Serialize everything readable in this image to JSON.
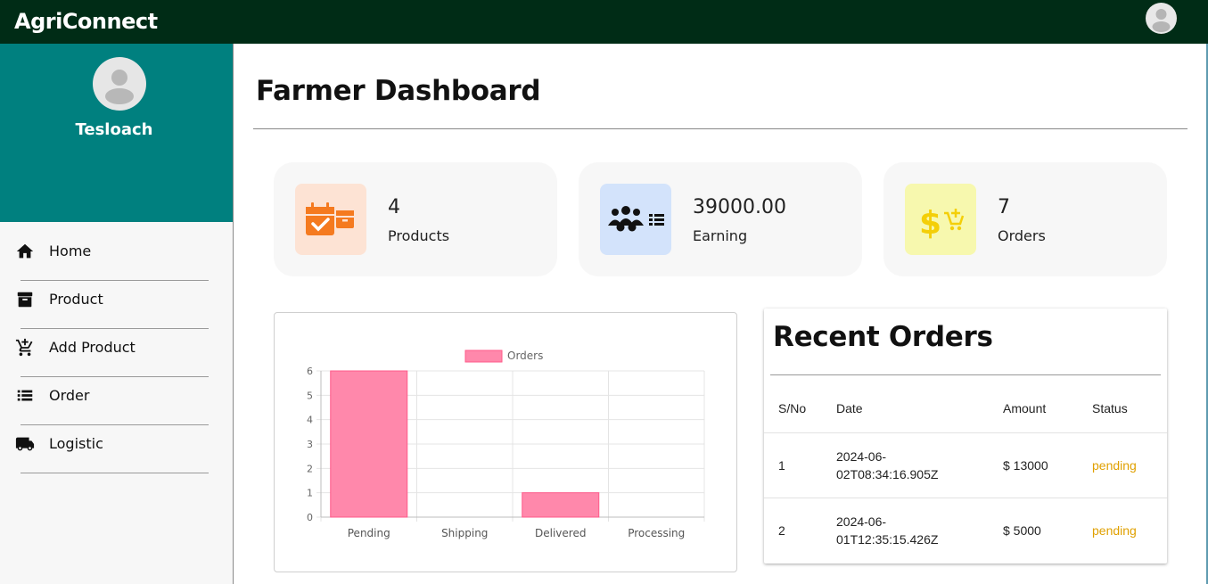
{
  "app": {
    "brand": "AgriConnect"
  },
  "sidebar": {
    "username": "Tesloach",
    "items": [
      {
        "label": "Home",
        "icon": "home-icon"
      },
      {
        "label": "Product",
        "icon": "archive-icon"
      },
      {
        "label": "Add Product",
        "icon": "add-cart-icon"
      },
      {
        "label": "Order",
        "icon": "list-icon"
      },
      {
        "label": "Logistic",
        "icon": "truck-icon"
      }
    ]
  },
  "page": {
    "title": "Farmer Dashboard"
  },
  "stats": [
    {
      "value": "4",
      "caption": "Products",
      "icon": "calendar-box-icon",
      "bg": "#fde3d4",
      "fg": "#f57a1f"
    },
    {
      "value": "39000.00",
      "caption": "Earning",
      "icon": "people-list-icon",
      "bg": "#d3e3fb",
      "fg": "#111111"
    },
    {
      "value": "7",
      "caption": "Orders",
      "icon": "dollar-cart-icon",
      "bg": "#f7f8ae",
      "fg": "#f4cf08"
    }
  ],
  "chart_data": {
    "type": "bar",
    "categories": [
      "Pending",
      "Shipping",
      "Delivered",
      "Processing"
    ],
    "series": [
      {
        "name": "Orders",
        "values": [
          6,
          0,
          1,
          0
        ]
      }
    ],
    "ylim": [
      0,
      6
    ],
    "yticks": [
      "0",
      "1",
      "2",
      "3",
      "4",
      "5",
      "6"
    ],
    "legend": "top",
    "grid": true,
    "bar_color": "#ff88ab"
  },
  "orders": {
    "title": "Recent Orders",
    "headers": [
      "S/No",
      "Date",
      "Amount",
      "Status"
    ],
    "rows": [
      {
        "sno": "1",
        "date_a": "2024-06-",
        "date_b": "02T08:34:16.905Z",
        "amount": "$ 13000",
        "status": "pending"
      },
      {
        "sno": "2",
        "date_a": "2024-06-",
        "date_b": "01T12:35:15.426Z",
        "amount": "$ 5000",
        "status": "pending"
      }
    ]
  }
}
